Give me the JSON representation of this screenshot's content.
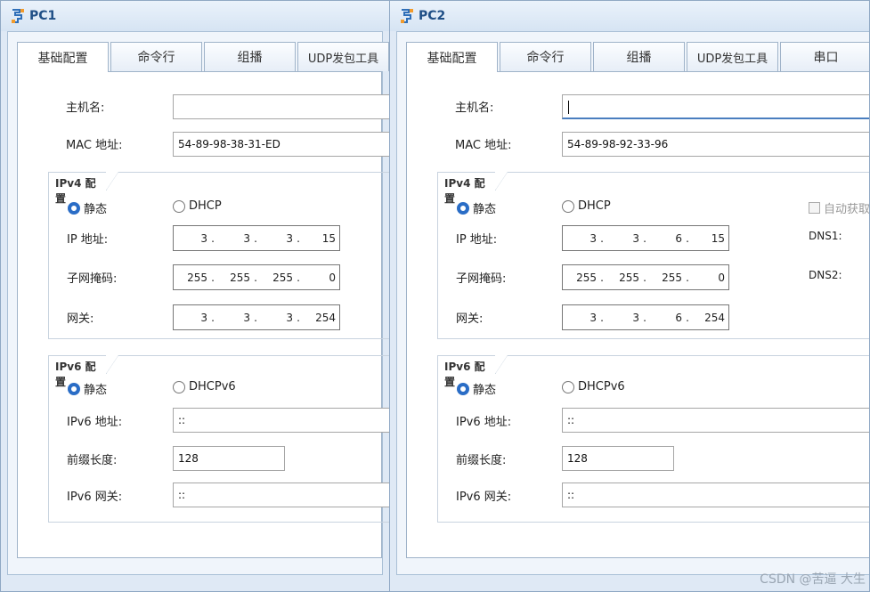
{
  "windows": [
    {
      "title": "PC1",
      "tabs": [
        {
          "label": "基础配置",
          "active": true
        },
        {
          "label": "命令行",
          "active": false
        },
        {
          "label": "组播",
          "active": false
        },
        {
          "label": "UDP发包工具",
          "active": false
        }
      ],
      "hostname_label": "主机名:",
      "hostname_value": "",
      "mac_label": "MAC 地址:",
      "mac_value": "54-89-98-38-31-ED",
      "ipv4": {
        "group_title": "IPv4 配置",
        "static_label": "静态",
        "dhcp_label": "DHCP",
        "ip_label": "IP 地址:",
        "ip": [
          "3",
          "3",
          "3",
          "15"
        ],
        "mask_label": "子网掩码:",
        "mask": [
          "255",
          "255",
          "255",
          "0"
        ],
        "gw_label": "网关:",
        "gw": [
          "3",
          "3",
          "3",
          "254"
        ]
      },
      "ipv6": {
        "group_title": "IPv6 配置",
        "static_label": "静态",
        "dhcp_label": "DHCPv6",
        "addr_label": "IPv6 地址:",
        "addr_value": "::",
        "prefix_label": "前缀长度:",
        "prefix_value": "128",
        "gw_label": "IPv6 网关:",
        "gw_value": "::"
      }
    },
    {
      "title": "PC2",
      "tabs": [
        {
          "label": "基础配置",
          "active": true
        },
        {
          "label": "命令行",
          "active": false
        },
        {
          "label": "组播",
          "active": false
        },
        {
          "label": "UDP发包工具",
          "active": false
        },
        {
          "label": "串口",
          "active": false
        }
      ],
      "hostname_label": "主机名:",
      "hostname_value": "",
      "mac_label": "MAC 地址:",
      "mac_value": "54-89-98-92-33-96",
      "ipv4": {
        "group_title": "IPv4 配置",
        "static_label": "静态",
        "dhcp_label": "DHCP",
        "auto_dns_label": "自动获取",
        "dns1_label": "DNS1:",
        "dns2_label": "DNS2:",
        "ip_label": "IP 地址:",
        "ip": [
          "3",
          "3",
          "6",
          "15"
        ],
        "mask_label": "子网掩码:",
        "mask": [
          "255",
          "255",
          "255",
          "0"
        ],
        "gw_label": "网关:",
        "gw": [
          "3",
          "3",
          "6",
          "254"
        ]
      },
      "ipv6": {
        "group_title": "IPv6 配置",
        "static_label": "静态",
        "dhcp_label": "DHCPv6",
        "addr_label": "IPv6 地址:",
        "addr_value": "::",
        "prefix_label": "前缀长度:",
        "prefix_value": "128",
        "gw_label": "IPv6 网关:",
        "gw_value": "::"
      }
    }
  ],
  "watermark": "CSDN @苦逼 大生",
  "colors": {
    "accent": "#2a6dc6",
    "title": "#1f4f86"
  },
  "icons": {
    "app": "network-pc-icon"
  }
}
